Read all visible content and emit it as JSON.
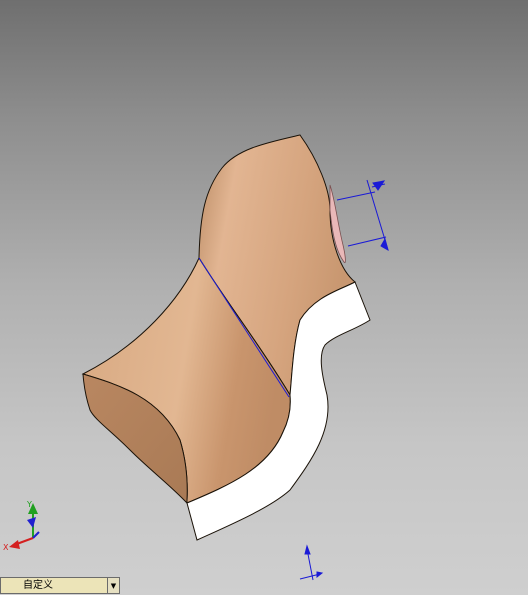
{
  "viewport": {
    "background_top": "#6f6f6f",
    "background_bottom": "#cfcfcf",
    "part_color": "#d9a77e",
    "cut_face_color": "#ffffff",
    "dimension_color": "#1a1ad6"
  },
  "triad": {
    "x_label": "X",
    "y_label": "Y",
    "x_color": "#d42020",
    "y_color": "#20a020",
    "z_color": "#2020d0"
  },
  "view_selector": {
    "value": "自定义",
    "dropdown_icon": "triangle-down"
  }
}
